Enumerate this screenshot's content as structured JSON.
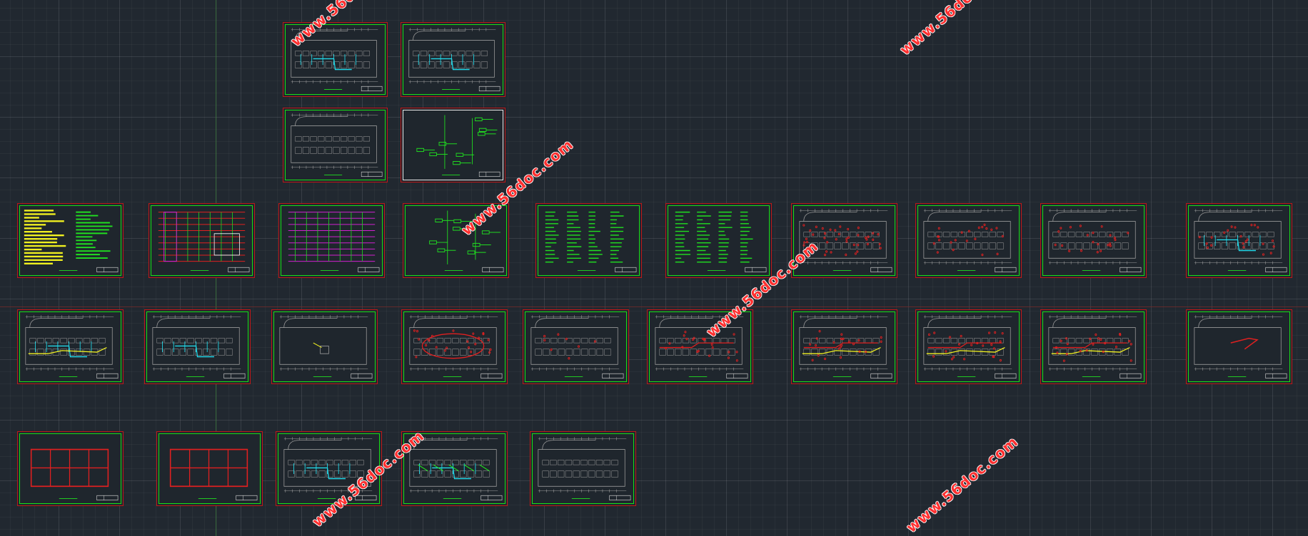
{
  "app": {
    "view": "CAD model space"
  },
  "watermark_text": "www.56doc.com",
  "colors": {
    "background": "#212830",
    "sheet_outer": "#c01818",
    "sheet_inner": "#18e018",
    "linework": "#9a9a9a",
    "accent_cyan": "#22d8e8",
    "accent_red": "#e02020",
    "accent_yellow": "#f0f020",
    "accent_magenta": "#d020d0",
    "accent_green": "#20e020"
  },
  "sheets": [
    {
      "id": "s01",
      "kind": "plan",
      "variant": "cyan"
    },
    {
      "id": "s02",
      "kind": "plan",
      "variant": "cyan-small"
    },
    {
      "id": "s03",
      "kind": "plan",
      "variant": "rooms"
    },
    {
      "id": "s04",
      "kind": "schematic",
      "variant": "white-frame"
    },
    {
      "id": "s05",
      "kind": "notes",
      "variant": "yellow-green"
    },
    {
      "id": "s06",
      "kind": "riser",
      "variant": "mixed"
    },
    {
      "id": "s07",
      "kind": "riser",
      "variant": "magenta"
    },
    {
      "id": "s08",
      "kind": "schematic",
      "variant": "green"
    },
    {
      "id": "s09",
      "kind": "schematic",
      "variant": "green-list"
    },
    {
      "id": "s10",
      "kind": "schematic",
      "variant": "green-list"
    },
    {
      "id": "s11",
      "kind": "plan",
      "variant": "red-dense"
    },
    {
      "id": "s12",
      "kind": "plan",
      "variant": "red"
    },
    {
      "id": "s13",
      "kind": "plan",
      "variant": "red"
    },
    {
      "id": "s14",
      "kind": "plan",
      "variant": "cyan-red"
    },
    {
      "id": "s15",
      "kind": "plan",
      "variant": "cyan-yellow"
    },
    {
      "id": "s16",
      "kind": "plan",
      "variant": "cyan"
    },
    {
      "id": "s17",
      "kind": "plan",
      "variant": "empty"
    },
    {
      "id": "s18",
      "kind": "plan",
      "variant": "red-ring"
    },
    {
      "id": "s19",
      "kind": "plan",
      "variant": "red-small"
    },
    {
      "id": "s20",
      "kind": "plan",
      "variant": "red-line"
    },
    {
      "id": "s21",
      "kind": "plan",
      "variant": "red-yellow"
    },
    {
      "id": "s22",
      "kind": "plan",
      "variant": "red-yellow"
    },
    {
      "id": "s23",
      "kind": "plan",
      "variant": "red-yellow"
    },
    {
      "id": "s24",
      "kind": "plan",
      "variant": "roof"
    },
    {
      "id": "s25",
      "kind": "structure",
      "variant": "red-grid"
    },
    {
      "id": "s26",
      "kind": "structure",
      "variant": "red-grid"
    },
    {
      "id": "s27",
      "kind": "plan",
      "variant": "cyan"
    },
    {
      "id": "s28",
      "kind": "plan",
      "variant": "green-cyan"
    },
    {
      "id": "s29",
      "kind": "plan",
      "variant": "rooms"
    }
  ]
}
